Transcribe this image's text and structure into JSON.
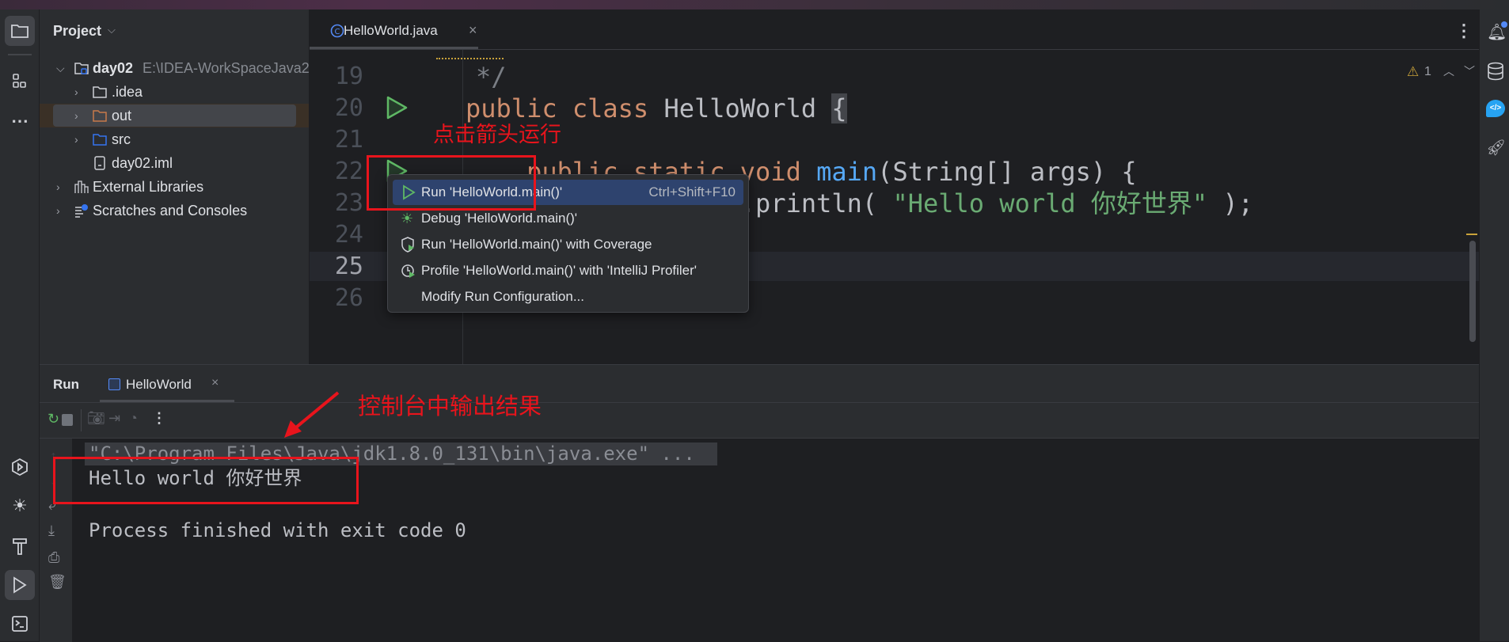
{
  "project_panel": {
    "title": "Project",
    "tree": [
      {
        "label": "day02",
        "path": "E:\\IDEA-WorkSpaceJava2"
      },
      {
        "label": ".idea"
      },
      {
        "label": "out"
      },
      {
        "label": "src"
      },
      {
        "label": "day02.iml"
      },
      {
        "label": "External Libraries"
      },
      {
        "label": "Scratches and Consoles"
      }
    ]
  },
  "editor": {
    "tab": {
      "label": "HelloWorld.java",
      "close": "×"
    },
    "warnings": {
      "icon": "warning-icon",
      "count": "1"
    },
    "line_numbers": [
      "19",
      "20",
      "21",
      "22",
      "23",
      "24",
      "25",
      "26"
    ],
    "code": {
      "l19": "*/",
      "l20": {
        "k1": "public",
        "k2": "class",
        "name": "HelloWorld",
        "brace": "{"
      },
      "l22": {
        "k1": "public",
        "k2": "static",
        "k3": "void",
        "fn": "main",
        "rest": "(String[] args) {"
      },
      "l23": {
        "pre": "System.out.println( ",
        "str": "\"Hello world 你好世界\"",
        "post": " );"
      }
    },
    "current_line": "25"
  },
  "context_menu": {
    "items": [
      {
        "label": "Run 'HelloWorld.main()'",
        "shortcut": "Ctrl+Shift+F10",
        "icon": "run-icon",
        "selected": true
      },
      {
        "label": "Debug 'HelloWorld.main()'",
        "icon": "debug-icon"
      },
      {
        "label": "Run 'HelloWorld.main()' with Coverage",
        "icon": "coverage-icon"
      },
      {
        "label": "Profile 'HelloWorld.main()' with 'IntelliJ Profiler'",
        "icon": "profiler-icon"
      },
      {
        "label": "Modify Run Configuration..."
      }
    ]
  },
  "annotations": {
    "click_arrow": "点击箭头运行",
    "console_output": "控制台中输出结果",
    "color": "#e8141c"
  },
  "run_panel": {
    "title": "Run",
    "tab": "HelloWorld",
    "console": [
      "\"C:\\Program Files\\Java\\jdk1.8.0_131\\bin\\java.exe\" ...",
      "Hello world 你好世界",
      "",
      "Process finished with exit code 0"
    ]
  },
  "colors": {
    "keyword": "#cf8e6d",
    "method": "#56a8f5",
    "string": "#6aab73",
    "selection": "#2e436e",
    "run_green": "#5fb865"
  }
}
